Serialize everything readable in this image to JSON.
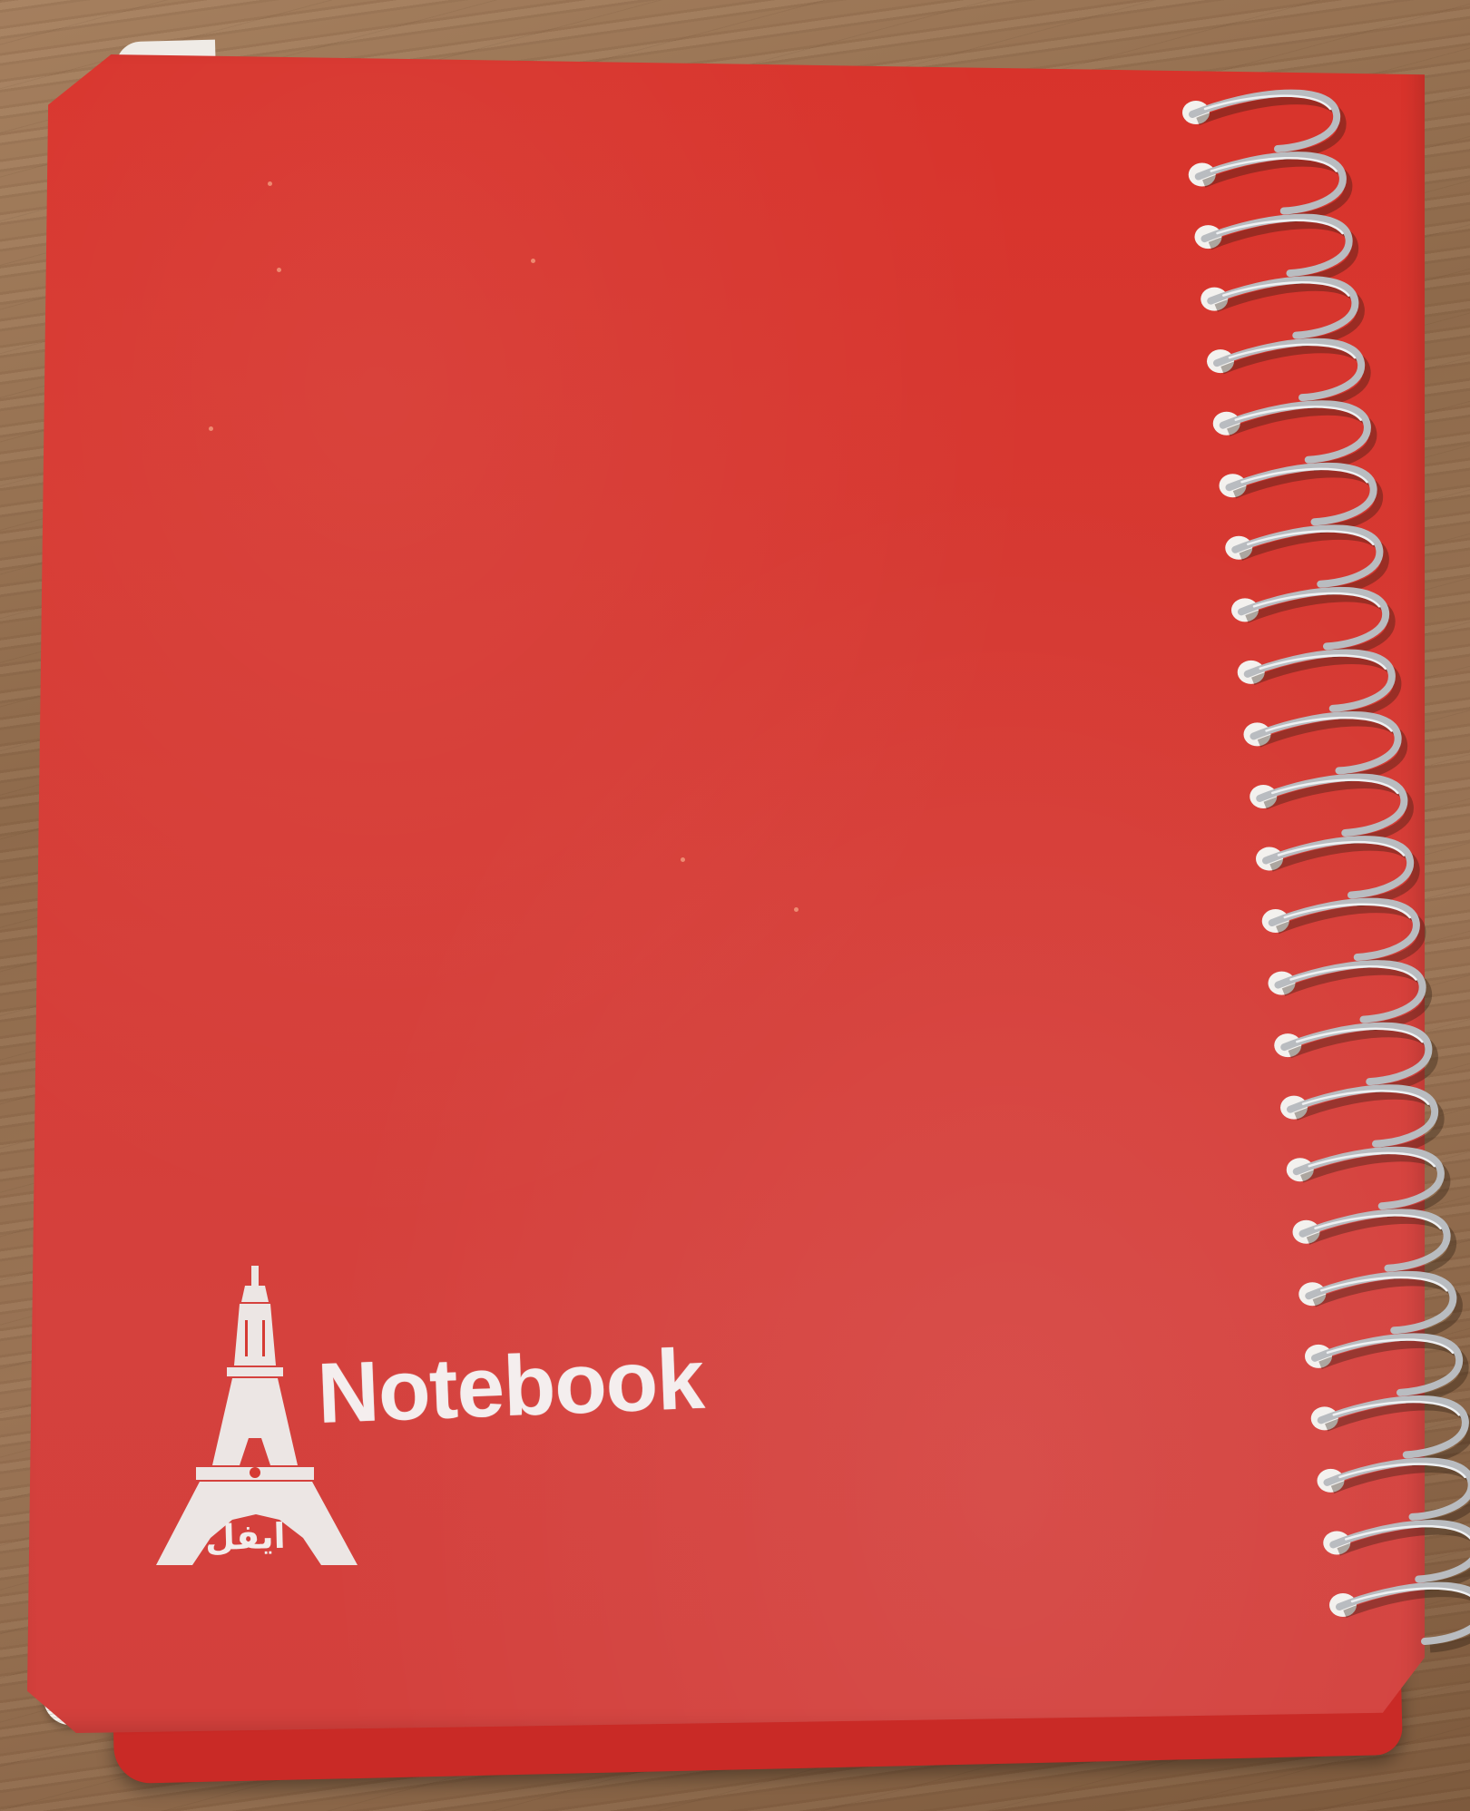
{
  "notebook": {
    "title": "Notebook",
    "brand_arabic": "ایفل",
    "logo_icon": "eiffel-tower-icon",
    "cover_color": "#d63a33",
    "emboss_color": "#f2ecea",
    "binding": "wire-spiral",
    "spiral_ring_count": 25,
    "spiral_color": "#b9bcc0"
  },
  "background": {
    "surface": "wood-table",
    "color": "#9a7455"
  }
}
